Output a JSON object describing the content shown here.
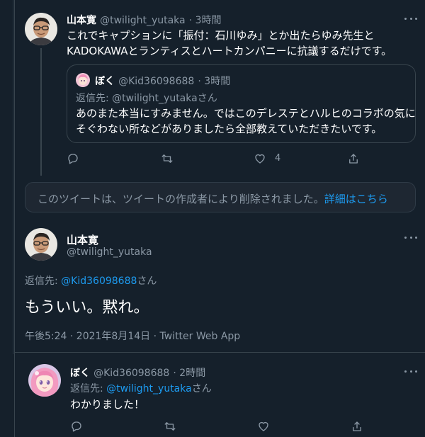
{
  "tweet1": {
    "name": "山本寛",
    "handle": "@twilight_yutaka",
    "time": "· 3時間",
    "line1": "これでキャプションに「振付：石川ゆみ」とか出たらゆみ先生と",
    "line2": "KADOKAWAとランティスとハートカンパニーに抗議するだけです。",
    "quote": {
      "name": "ぼく",
      "handle": "@Kid36098688",
      "time": "· 3時間",
      "reply_prefix": "返信先: ",
      "reply_to": "@twilight_yutaka",
      "reply_suffix": "さん",
      "line1": "あのまた本当にすみません。ではこのデレステとハルヒのコラボの気に",
      "line2": "そぐわない所などがありましたら全部教えていただきたいです。"
    },
    "like_count": "4"
  },
  "deleted_notice": {
    "text": "このツイートは、ツイートの作成者により削除されました。",
    "link": "詳細はこちら"
  },
  "main_tweet": {
    "name": "山本寛",
    "handle": "@twilight_yutaka",
    "reply_prefix": "返信先: ",
    "reply_to": "@Kid36098688",
    "reply_suffix": "さん",
    "text": "もういい。黙れ。",
    "meta": "午後5:24 · 2021年8月14日 · Twitter Web App"
  },
  "reply_tweet": {
    "name": "ぼく",
    "handle": "@Kid36098688",
    "time": "· 2時間",
    "reply_prefix": "返信先: ",
    "reply_to": "@twilight_yutaka",
    "reply_suffix": "さん",
    "text": "わかりました！"
  },
  "colors": {
    "background": "#15202b",
    "accent": "#1d9bf0",
    "muted": "#8b98a5",
    "border": "#38444d"
  }
}
